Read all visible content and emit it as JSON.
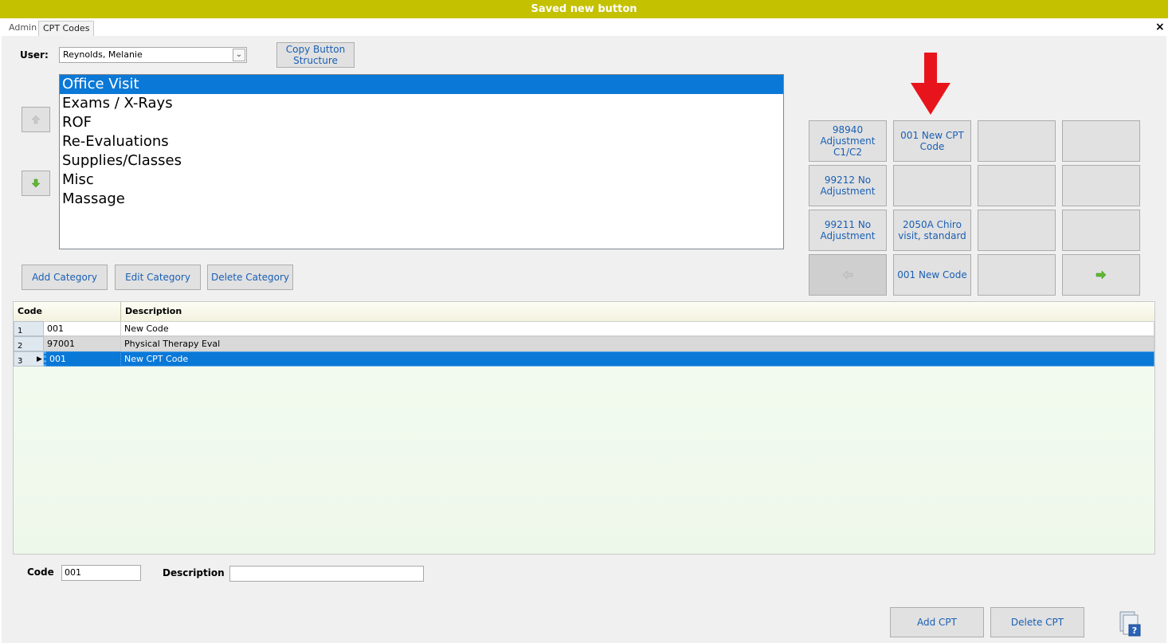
{
  "banner": {
    "message": "Saved new button",
    "color": "#c4c100"
  },
  "tabs": [
    {
      "label": "Admin"
    },
    {
      "label": "CPT Codes"
    }
  ],
  "close_label": "×",
  "user": {
    "label": "User:",
    "value": "Reynolds, Melanie"
  },
  "copy_button": {
    "line1": "Copy Button",
    "line2": "Structure"
  },
  "categories": [
    "Office Visit",
    "Exams / X-Rays",
    "ROF",
    "Re-Evaluations",
    "Supplies/Classes",
    "Misc",
    "Massage"
  ],
  "selected_category": "Office Visit",
  "category_buttons": {
    "add": "Add Category",
    "edit": "Edit Category",
    "delete": "Delete Category"
  },
  "button_grid": {
    "cells": [
      [
        "98940\nAdjustment\nC1/C2",
        "001 New CPT\nCode",
        "",
        ""
      ],
      [
        "99212 No\nAdjustment",
        "",
        "",
        ""
      ],
      [
        "99211 No\nAdjustment",
        "2050A Chiro\nvisit, standard",
        "",
        ""
      ],
      [
        "prev-page-arrow",
        "001 New Code",
        "",
        "next-page-arrow"
      ]
    ]
  },
  "annotation": {
    "icon": "red-down-arrow",
    "color": "#e8141c"
  },
  "table": {
    "columns": [
      "Code",
      "Description"
    ],
    "rows": [
      {
        "num": "1",
        "code": "001",
        "description": "New Code"
      },
      {
        "num": "2",
        "code": "97001",
        "description": "Physical Therapy Eval"
      },
      {
        "num": "3",
        "code": "001",
        "description": "New CPT Code"
      }
    ],
    "selected_row": 3
  },
  "form": {
    "code_label": "Code",
    "code_value": "001",
    "description_label": "Description",
    "description_value": ""
  },
  "actions": {
    "add_cpt": "Add CPT",
    "delete_cpt": "Delete CPT"
  },
  "colors": {
    "accent": "#1a5fb4",
    "selection": "#0a78d7"
  }
}
